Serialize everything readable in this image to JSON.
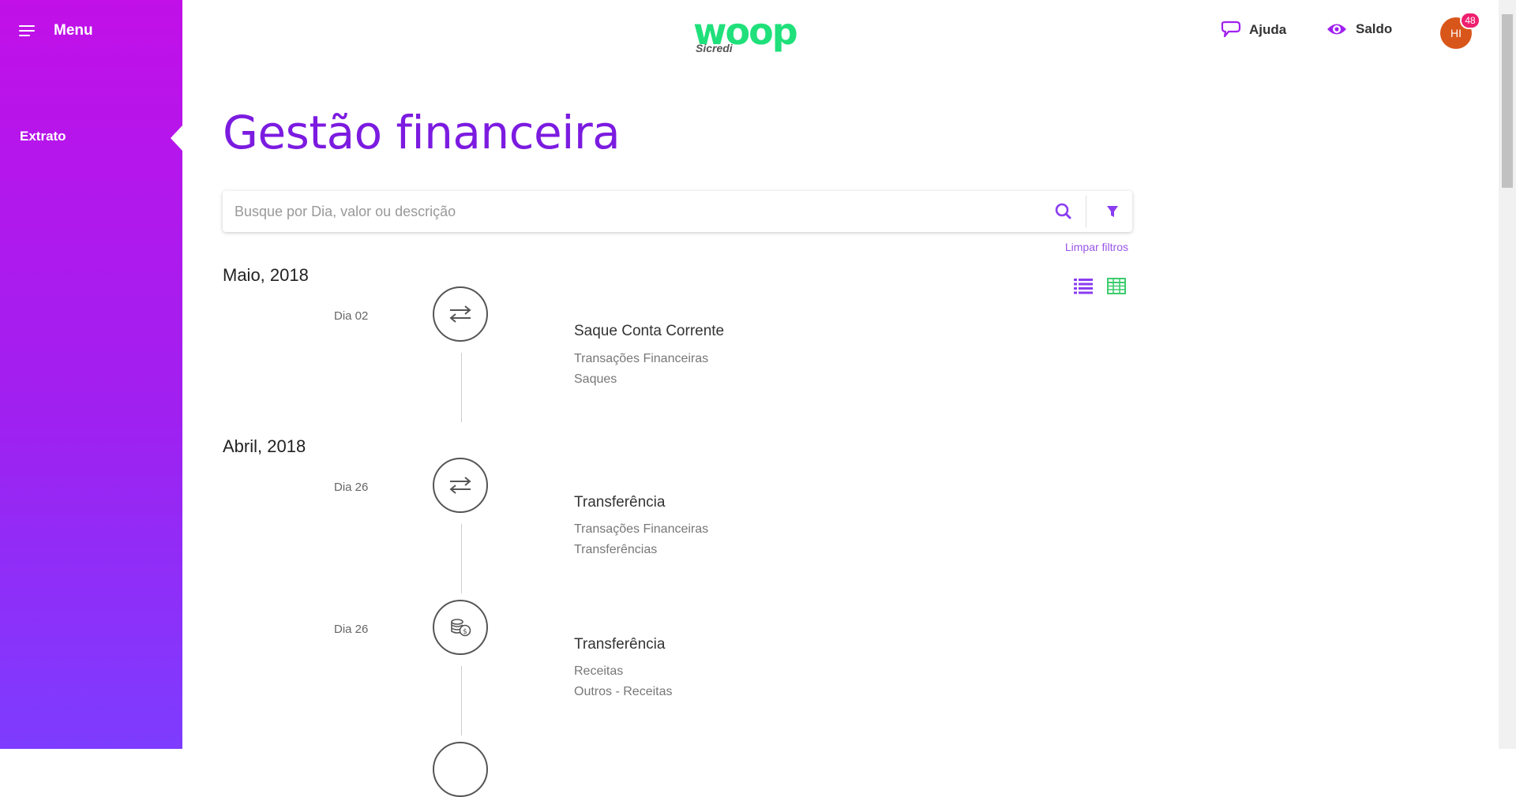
{
  "sidebar": {
    "menu_label": "Menu",
    "items": [
      {
        "label": "Extrato"
      }
    ]
  },
  "header": {
    "logo_text": "woop",
    "logo_sub": "Sicredi",
    "help_label": "Ajuda",
    "balance_label": "Saldo",
    "avatar_initials": "HI",
    "notification_count": "48"
  },
  "main": {
    "title": "Gestão financeira",
    "search": {
      "placeholder": "Busque por Dia, valor ou descrição",
      "value": ""
    },
    "clear_filters": "Limpar filtros",
    "months": [
      {
        "label": "Maio, 2018",
        "transactions": [
          {
            "day": "Dia 02",
            "icon": "transfer-arrows-icon",
            "title": "Saque Conta Corrente",
            "category": "Transações Financeiras",
            "subcategory": "Saques"
          }
        ]
      },
      {
        "label": "Abril, 2018",
        "transactions": [
          {
            "day": "Dia 26",
            "icon": "transfer-arrows-icon",
            "title": "Transferência",
            "category": "Transações Financeiras",
            "subcategory": "Transferências"
          },
          {
            "day": "Dia 26",
            "icon": "coins-icon",
            "title": "Transferência",
            "category": "Receitas",
            "subcategory": "Outros - Receitas"
          }
        ]
      }
    ]
  },
  "colors": {
    "sidebar_top": "#c110e8",
    "sidebar_bottom": "#7d3cff",
    "title": "#7c1be0",
    "logo": "#1fe07a",
    "table_view": "#3dcc6e",
    "list_view": "#8a3cf0",
    "badge": "#ee1f6e",
    "avatar": "#d9561a"
  }
}
